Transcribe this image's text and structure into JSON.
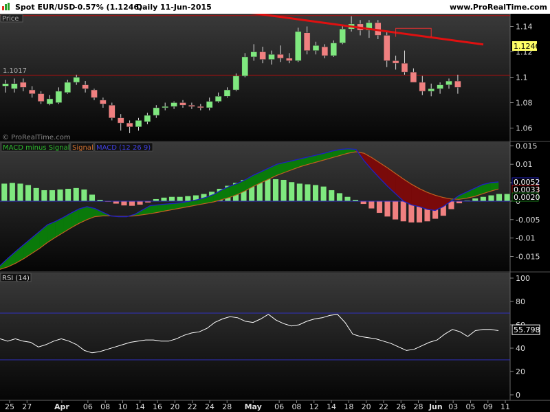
{
  "header": {
    "symbol": "Spot EUR/USD",
    "change": "-0.57% (1.1246)",
    "period": "Daily",
    "date": "11-Jun-2015",
    "brand": "www.ProRealTime.com"
  },
  "colors": {
    "up": "#7fe87f",
    "down": "#f08080",
    "trend": "#e01010",
    "hline": "#b01010",
    "macd": "#2020c0",
    "signal": "#c06020",
    "fill_pos": "#0a7a0a",
    "fill_neg": "#7a0a0a",
    "rsi": "#ffffff",
    "rsi_bands": "#3030c0",
    "price_tag": "#ffff66"
  },
  "chart_data": [
    {
      "type": "candlestick",
      "panel": "price",
      "title": "Price",
      "watermark": "© ProRealTime.com",
      "y_ticks": [
        "1.14",
        "1.12",
        "1.1",
        "1.08",
        "1.06"
      ],
      "ylim": [
        1.05,
        1.15
      ],
      "hline": {
        "value": 1.1017,
        "label": "1.1017"
      },
      "hline_top": 1.1485,
      "last_price": "1.1246",
      "trendline": {
        "from": {
          "i": 21,
          "v": 1.157
        },
        "to": {
          "i": 50,
          "v": 1.1258
        }
      },
      "annotation_box": {
        "from_i": 44,
        "to_i": 48,
        "top": 1.1385,
        "bottom": 1.1318
      },
      "candles": [
        {
          "o": 1.093,
          "h": 1.098,
          "l": 1.088,
          "c": 1.095
        },
        {
          "o": 1.091,
          "h": 1.099,
          "l": 1.088,
          "c": 1.095
        },
        {
          "o": 1.096,
          "h": 1.099,
          "l": 1.089,
          "c": 1.092
        },
        {
          "o": 1.09,
          "h": 1.093,
          "l": 1.084,
          "c": 1.087
        },
        {
          "o": 1.087,
          "h": 1.089,
          "l": 1.079,
          "c": 1.081
        },
        {
          "o": 1.079,
          "h": 1.086,
          "l": 1.078,
          "c": 1.083
        },
        {
          "o": 1.08,
          "h": 1.092,
          "l": 1.079,
          "c": 1.089
        },
        {
          "o": 1.088,
          "h": 1.098,
          "l": 1.087,
          "c": 1.096
        },
        {
          "o": 1.096,
          "h": 1.102,
          "l": 1.094,
          "c": 1.1
        },
        {
          "o": 1.094,
          "h": 1.097,
          "l": 1.088,
          "c": 1.091
        },
        {
          "o": 1.09,
          "h": 1.091,
          "l": 1.082,
          "c": 1.084
        },
        {
          "o": 1.082,
          "h": 1.084,
          "l": 1.076,
          "c": 1.079
        },
        {
          "o": 1.078,
          "h": 1.08,
          "l": 1.066,
          "c": 1.068
        },
        {
          "o": 1.068,
          "h": 1.071,
          "l": 1.058,
          "c": 1.064
        },
        {
          "o": 1.064,
          "h": 1.066,
          "l": 1.056,
          "c": 1.061
        },
        {
          "o": 1.061,
          "h": 1.068,
          "l": 1.058,
          "c": 1.066
        },
        {
          "o": 1.065,
          "h": 1.072,
          "l": 1.063,
          "c": 1.07
        },
        {
          "o": 1.07,
          "h": 1.078,
          "l": 1.068,
          "c": 1.076
        },
        {
          "o": 1.076,
          "h": 1.08,
          "l": 1.074,
          "c": 1.077
        },
        {
          "o": 1.077,
          "h": 1.081,
          "l": 1.075,
          "c": 1.08
        },
        {
          "o": 1.08,
          "h": 1.082,
          "l": 1.076,
          "c": 1.078
        },
        {
          "o": 1.078,
          "h": 1.08,
          "l": 1.075,
          "c": 1.077
        },
        {
          "o": 1.077,
          "h": 1.079,
          "l": 1.074,
          "c": 1.076
        },
        {
          "o": 1.076,
          "h": 1.084,
          "l": 1.074,
          "c": 1.081
        },
        {
          "o": 1.081,
          "h": 1.088,
          "l": 1.08,
          "c": 1.085
        },
        {
          "o": 1.085,
          "h": 1.092,
          "l": 1.084,
          "c": 1.09
        },
        {
          "o": 1.09,
          "h": 1.103,
          "l": 1.089,
          "c": 1.101
        },
        {
          "o": 1.101,
          "h": 1.119,
          "l": 1.1,
          "c": 1.116
        },
        {
          "o": 1.116,
          "h": 1.126,
          "l": 1.113,
          "c": 1.12
        },
        {
          "o": 1.12,
          "h": 1.124,
          "l": 1.111,
          "c": 1.114
        },
        {
          "o": 1.114,
          "h": 1.121,
          "l": 1.11,
          "c": 1.118
        },
        {
          "o": 1.118,
          "h": 1.125,
          "l": 1.112,
          "c": 1.115
        },
        {
          "o": 1.115,
          "h": 1.119,
          "l": 1.111,
          "c": 1.113
        },
        {
          "o": 1.113,
          "h": 1.139,
          "l": 1.112,
          "c": 1.136
        },
        {
          "o": 1.135,
          "h": 1.14,
          "l": 1.118,
          "c": 1.121
        },
        {
          "o": 1.121,
          "h": 1.128,
          "l": 1.118,
          "c": 1.125
        },
        {
          "o": 1.124,
          "h": 1.126,
          "l": 1.115,
          "c": 1.117
        },
        {
          "o": 1.117,
          "h": 1.129,
          "l": 1.116,
          "c": 1.127
        },
        {
          "o": 1.127,
          "h": 1.141,
          "l": 1.126,
          "c": 1.138
        },
        {
          "o": 1.138,
          "h": 1.148,
          "l": 1.136,
          "c": 1.142
        },
        {
          "o": 1.142,
          "h": 1.145,
          "l": 1.133,
          "c": 1.137
        },
        {
          "o": 1.137,
          "h": 1.145,
          "l": 1.131,
          "c": 1.143
        },
        {
          "o": 1.143,
          "h": 1.145,
          "l": 1.13,
          "c": 1.133
        },
        {
          "o": 1.133,
          "h": 1.136,
          "l": 1.108,
          "c": 1.113
        },
        {
          "o": 1.113,
          "h": 1.117,
          "l": 1.106,
          "c": 1.111
        },
        {
          "o": 1.111,
          "h": 1.121,
          "l": 1.102,
          "c": 1.104
        },
        {
          "o": 1.104,
          "h": 1.107,
          "l": 1.098,
          "c": 1.096
        },
        {
          "o": 1.096,
          "h": 1.101,
          "l": 1.086,
          "c": 1.089
        },
        {
          "o": 1.089,
          "h": 1.095,
          "l": 1.085,
          "c": 1.091
        },
        {
          "o": 1.091,
          "h": 1.096,
          "l": 1.087,
          "c": 1.094
        },
        {
          "o": 1.094,
          "h": 1.099,
          "l": 1.091,
          "c": 1.097
        },
        {
          "o": 1.097,
          "h": 1.102,
          "l": 1.087,
          "c": 1.092
        }
      ]
    },
    {
      "type": "macd",
      "panel": "macd",
      "legend": [
        {
          "name": "MACD minus Signal",
          "color": "#2fb82f"
        },
        {
          "name": "Signal",
          "color": "#d07030"
        },
        {
          "name": "MACD (12 26 9)",
          "color": "#4040e0"
        }
      ],
      "y_ticks": [
        "0.015",
        "0.01",
        "0.005",
        "0",
        "-0.005",
        "-0.01",
        "-0.015"
      ],
      "ylim": [
        -0.019,
        0.016
      ],
      "labels": [
        "0.0052",
        "0.0033",
        "0.0020"
      ],
      "hist": [
        0.0048,
        0.005,
        0.0048,
        0.0044,
        0.0036,
        0.003,
        0.003,
        0.0032,
        0.0034,
        0.0036,
        0.0032,
        0.0018,
        0.0004,
        -0.0002,
        -0.0007,
        -0.0012,
        -0.0013,
        -0.001,
        -0.0004,
        0.0006,
        0.001,
        0.0012,
        0.0012,
        0.0014,
        0.0016,
        0.002,
        0.0026,
        0.0034,
        0.0042,
        0.005,
        0.0058,
        0.0062,
        0.0058,
        0.006,
        0.006,
        0.0058,
        0.0052,
        0.0048,
        0.0046,
        0.0044,
        0.004,
        0.003,
        0.0022,
        0.0012,
        0.0004,
        -0.0008,
        -0.002,
        -0.0032,
        -0.0042,
        -0.005,
        -0.0055,
        -0.0058,
        -0.0058,
        -0.0055,
        -0.0048,
        -0.004,
        -0.0022,
        -0.0006,
        0.0002,
        0.0008,
        0.0012,
        0.0016,
        0.002,
        0.002
      ],
      "macd": [
        -0.0175,
        -0.0155,
        -0.0136,
        -0.0118,
        -0.01,
        -0.0082,
        -0.0064,
        -0.0055,
        -0.0044,
        -0.0032,
        -0.0021,
        -0.0015,
        -0.002,
        -0.003,
        -0.004,
        -0.0042,
        -0.0042,
        -0.0036,
        -0.0024,
        -0.0012,
        -0.001,
        -0.0008,
        -0.0006,
        -0.0004,
        0.0,
        0.0004,
        0.001,
        0.0018,
        0.003,
        0.004,
        0.0048,
        0.0058,
        0.007,
        0.008,
        0.009,
        0.01,
        0.0105,
        0.011,
        0.0115,
        0.012,
        0.0125,
        0.013,
        0.0136,
        0.014,
        0.0142,
        0.014,
        0.011,
        0.0085,
        0.0062,
        0.004,
        0.002,
        0.0,
        -0.001,
        -0.0015,
        -0.0022,
        -0.0025,
        -0.0015,
        0.0,
        0.0015,
        0.0025,
        0.0035,
        0.0045,
        0.005,
        0.0052
      ],
      "signal": [
        -0.0185,
        -0.0178,
        -0.0168,
        -0.0156,
        -0.0142,
        -0.0128,
        -0.0112,
        -0.0098,
        -0.0085,
        -0.0072,
        -0.006,
        -0.005,
        -0.0042,
        -0.004,
        -0.004,
        -0.0041,
        -0.0041,
        -0.004,
        -0.0037,
        -0.0034,
        -0.003,
        -0.0026,
        -0.0022,
        -0.0018,
        -0.0014,
        -0.001,
        -0.0006,
        -0.0002,
        0.0004,
        0.001,
        0.0018,
        0.0028,
        0.004,
        0.005,
        0.006,
        0.007,
        0.0078,
        0.0086,
        0.0094,
        0.01,
        0.0106,
        0.0112,
        0.0118,
        0.0124,
        0.013,
        0.0134,
        0.013,
        0.0118,
        0.0104,
        0.009,
        0.0075,
        0.006,
        0.0046,
        0.0034,
        0.0024,
        0.0016,
        0.001,
        0.0006,
        0.0005,
        0.0008,
        0.0013,
        0.002,
        0.0027,
        0.0033
      ]
    },
    {
      "type": "line",
      "panel": "rsi",
      "title": "RSI (14)",
      "y_ticks": [
        "100",
        "80",
        "60",
        "40",
        "20",
        "0"
      ],
      "ylim": [
        0,
        100
      ],
      "bands": [
        70,
        30
      ],
      "last_label": "55.798",
      "values": [
        48,
        46,
        48,
        46,
        45,
        41,
        43,
        46,
        48,
        46,
        43,
        38,
        36,
        37,
        39,
        41,
        43,
        45,
        46,
        47,
        47,
        46,
        46,
        48,
        51,
        53,
        54,
        57,
        62,
        65,
        67,
        66,
        63,
        62,
        65,
        69,
        64,
        61,
        59,
        60,
        63,
        65,
        66,
        68,
        69,
        62,
        52,
        50,
        49,
        48,
        46,
        44,
        41,
        38,
        39,
        42,
        45,
        47,
        52,
        56,
        54,
        50,
        55,
        56,
        56,
        55
      ]
    }
  ],
  "x_axis": {
    "labels": [
      {
        "i": 0,
        "t": "25"
      },
      {
        "i": 2,
        "t": "27"
      },
      {
        "i": 6,
        "t": "Apr"
      },
      {
        "i": 9,
        "t": "06"
      },
      {
        "i": 11,
        "t": "08"
      },
      {
        "i": 13,
        "t": "10"
      },
      {
        "i": 15,
        "t": "14"
      },
      {
        "i": 17,
        "t": "16"
      },
      {
        "i": 19,
        "t": "20"
      },
      {
        "i": 21,
        "t": "22"
      },
      {
        "i": 23,
        "t": "24"
      },
      {
        "i": 25,
        "t": "28"
      },
      {
        "i": 28,
        "t": "May"
      },
      {
        "i": 31,
        "t": "06"
      },
      {
        "i": 33,
        "t": "08"
      },
      {
        "i": 35,
        "t": "12"
      },
      {
        "i": 37,
        "t": "14"
      },
      {
        "i": 39,
        "t": "18"
      },
      {
        "i": 41,
        "t": "20"
      },
      {
        "i": 43,
        "t": "22"
      },
      {
        "i": 45,
        "t": "26"
      },
      {
        "i": 47,
        "t": "28"
      },
      {
        "i": 49,
        "t": "Jun"
      },
      {
        "i": 51,
        "t": "03"
      },
      {
        "i": 53,
        "t": "05"
      },
      {
        "i": 55,
        "t": "09"
      },
      {
        "i": 57,
        "t": "11"
      }
    ]
  }
}
